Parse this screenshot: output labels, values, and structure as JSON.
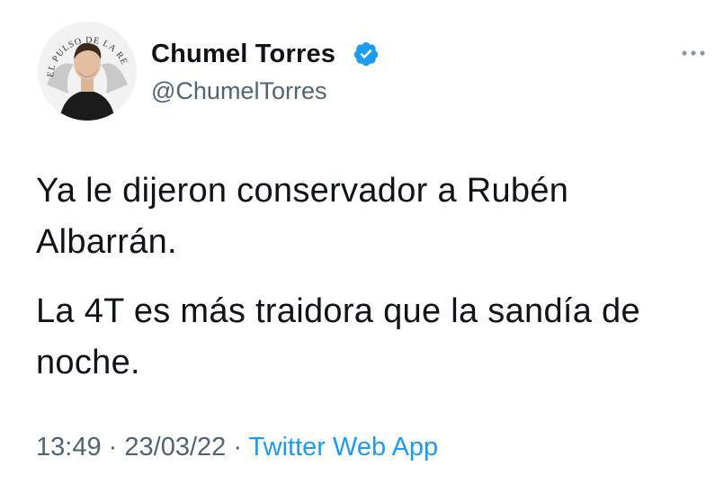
{
  "author": {
    "display_name": "Chumel Torres",
    "handle": "@ChumelTorres",
    "avatar_badge_text": "EL PULSO DE LA REPÚBLICA",
    "verified": true
  },
  "tweet": {
    "paragraphs": [
      "Ya le dijeron conservador a Rubén Albarrán.",
      "La 4T es más traidora que la sandía de noche."
    ]
  },
  "meta": {
    "time": "13:49",
    "separator": "·",
    "date": "23/03/22",
    "source": "Twitter Web App"
  },
  "icons": {
    "verified": "verified-badge-icon",
    "more": "more-options-icon"
  },
  "colors": {
    "text": "#0f1419",
    "secondary": "#536471",
    "accent": "#1d9bf0",
    "background": "#ffffff"
  }
}
